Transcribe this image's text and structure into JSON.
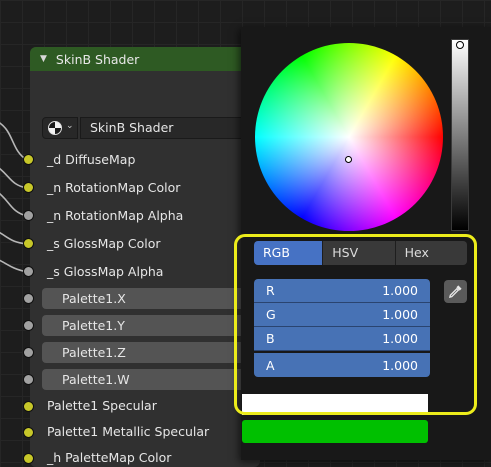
{
  "node": {
    "title": "SkinB Shader",
    "shader_name": "SkinB Shader",
    "sockets": [
      {
        "label": "_d DiffuseMap",
        "color": "#c7c729"
      },
      {
        "label": "_n RotationMap Color",
        "color": "#c7c729"
      },
      {
        "label": "_n RotationMap Alpha",
        "color": "#a1a1a1"
      },
      {
        "label": "_s GlossMap Color",
        "color": "#c7c729"
      },
      {
        "label": "_s GlossMap Alpha",
        "color": "#a1a1a1"
      },
      {
        "label": "Palette1.X",
        "color": "#a1a1a1"
      },
      {
        "label": "Palette1.Y",
        "color": "#a1a1a1"
      },
      {
        "label": "Palette1.Z",
        "color": "#a1a1a1"
      },
      {
        "label": "Palette1.W",
        "color": "#a1a1a1"
      },
      {
        "label": "Palette1 Specular",
        "color": "#c7c729"
      },
      {
        "label": "Palette1 Metallic Specular",
        "color": "#c7c729"
      },
      {
        "label": "_h PaletteMap Color",
        "color": "#c7c729"
      }
    ]
  },
  "color_picker": {
    "tabs": [
      "RGB",
      "HSV",
      "Hex"
    ],
    "active_tab": "RGB",
    "channels": [
      {
        "label": "R",
        "value": "1.000"
      },
      {
        "label": "G",
        "value": "1.000"
      },
      {
        "label": "B",
        "value": "1.000"
      },
      {
        "label": "A",
        "value": "1.000"
      }
    ],
    "current_color": "#ffffff",
    "previous_color": "#00c000",
    "highlight_color": "#ecec1b",
    "accent": "#4772b5"
  }
}
